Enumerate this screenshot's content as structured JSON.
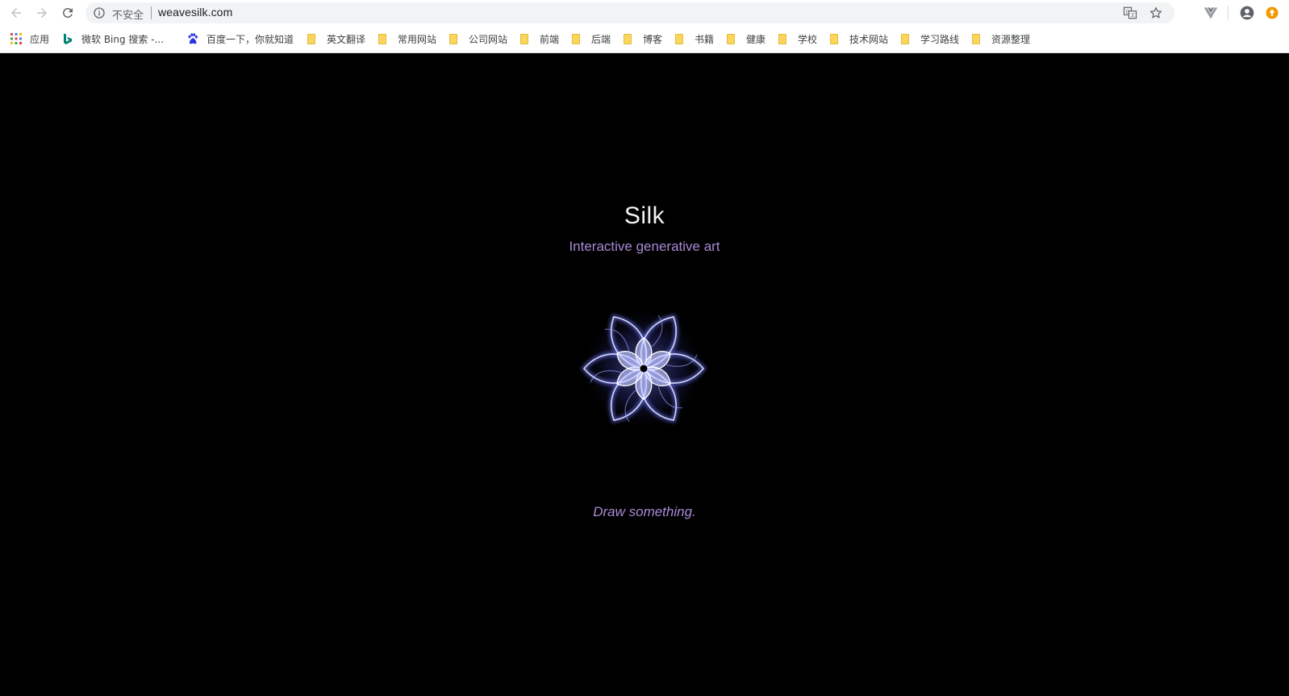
{
  "browser": {
    "security_label": "不安全",
    "url": "weavesilk.com",
    "icons": {
      "back": "arrow-left-icon",
      "forward": "arrow-right-icon",
      "reload": "reload-icon",
      "info": "info-icon",
      "translate": "translate-icon",
      "bookmark_star": "star-icon",
      "extension": "vue-extension-icon",
      "profile": "account-icon",
      "update": "update-icon"
    }
  },
  "bookmarks": [
    {
      "label": "应用",
      "icon": "apps-grid-icon"
    },
    {
      "label": "微软 Bing 搜索 -...",
      "icon": "bing-icon"
    },
    {
      "label": "百度一下，你就知道",
      "icon": "baidu-paw-icon"
    },
    {
      "label": "英文翻译",
      "icon": "folder-icon"
    },
    {
      "label": "常用网站",
      "icon": "folder-icon"
    },
    {
      "label": "公司网站",
      "icon": "folder-icon"
    },
    {
      "label": "前端",
      "icon": "folder-icon"
    },
    {
      "label": "后端",
      "icon": "folder-icon"
    },
    {
      "label": "博客",
      "icon": "folder-icon"
    },
    {
      "label": "书籍",
      "icon": "folder-icon"
    },
    {
      "label": "健康",
      "icon": "folder-icon"
    },
    {
      "label": "学校",
      "icon": "folder-icon"
    },
    {
      "label": "技术网站",
      "icon": "folder-icon"
    },
    {
      "label": "学习路线",
      "icon": "folder-icon"
    },
    {
      "label": "资源整理",
      "icon": "folder-icon"
    }
  ],
  "page": {
    "title": "Silk",
    "subtitle": "Interactive generative art",
    "prompt": "Draw something.",
    "colors": {
      "background": "#000000",
      "title": "#f2f2f2",
      "accent": "#a88ad6",
      "art_glow": "#6f78ff"
    }
  }
}
